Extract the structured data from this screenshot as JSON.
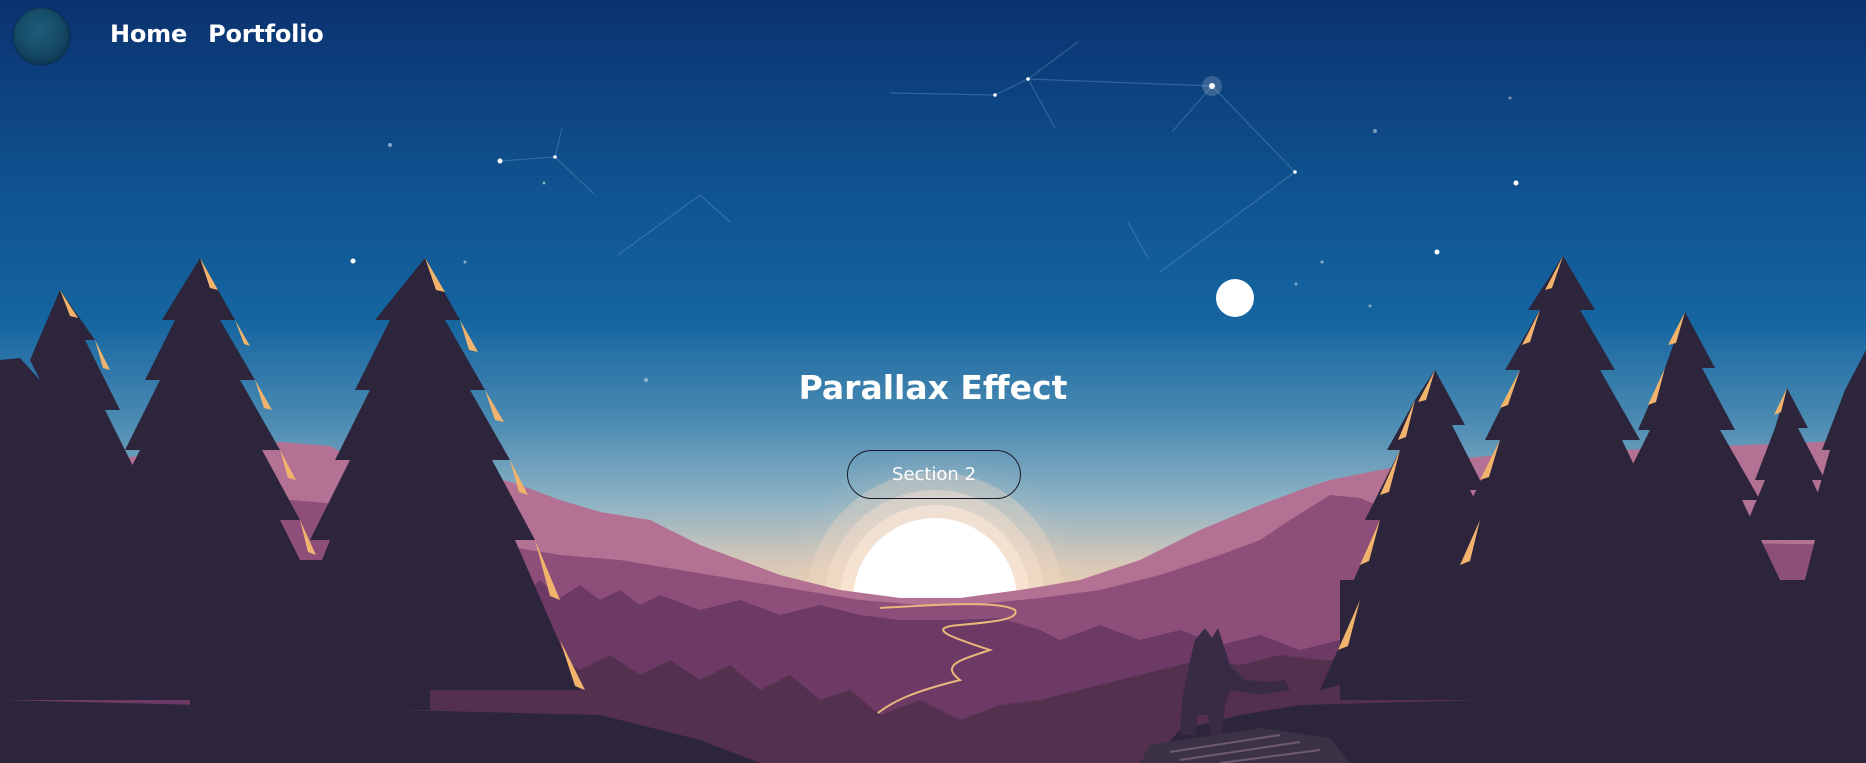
{
  "nav": {
    "logo_icon": "globe-logo-icon",
    "links": [
      {
        "label": "Home"
      },
      {
        "label": "Portfolio"
      }
    ]
  },
  "hero": {
    "title": "Parallax Effect",
    "button_label": "Section 2"
  },
  "colors": {
    "sky_top": "#0b3270",
    "sky_mid": "#12649c",
    "sky_horizon": "#e8c8a0",
    "mountain_far": "#b07090",
    "mountain_mid": "#8a4e78",
    "forest": "#5a3358",
    "tree_dark": "#2c253b",
    "tree_highlight": "#f2b46c",
    "sun": "#ffffff",
    "text": "#ffffff"
  }
}
